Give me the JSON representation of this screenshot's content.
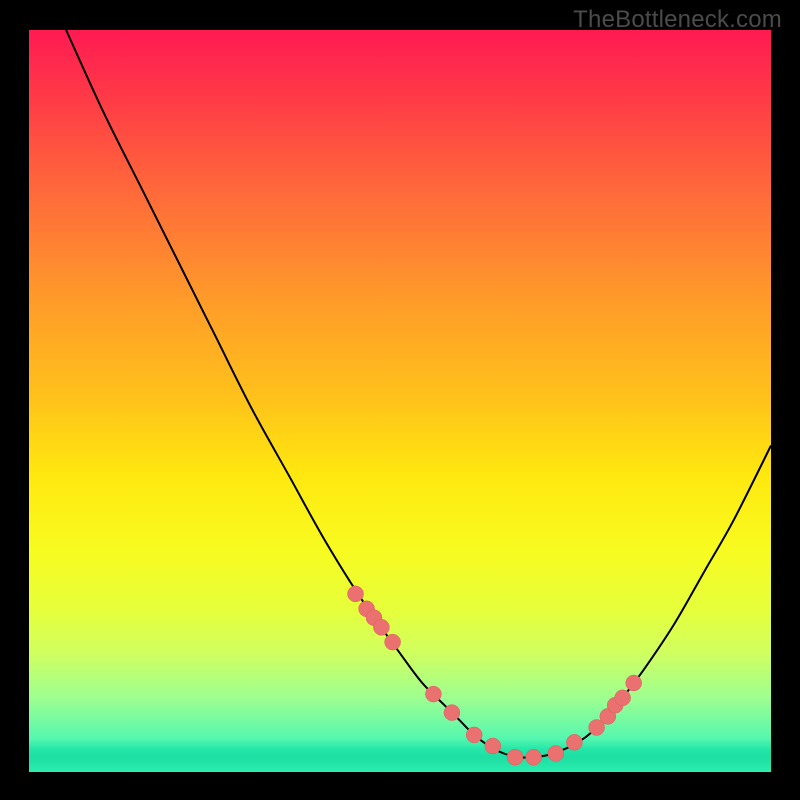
{
  "watermark": "TheBottleneck.com",
  "chart_data": {
    "type": "line",
    "title": "",
    "xlabel": "",
    "ylabel": "",
    "xlim": [
      0,
      100
    ],
    "ylim": [
      0,
      100
    ],
    "grid": false,
    "legend": false,
    "colors": {
      "curve": "#000000",
      "dots": "#eb7070",
      "gradient_top": "#ff1a52",
      "gradient_bottom": "#2aeeb0"
    },
    "series": [
      {
        "name": "bottleneck-curve",
        "x": [
          5,
          10,
          15,
          20,
          25,
          30,
          35,
          40,
          45,
          50,
          53,
          56,
          58,
          60,
          62,
          64,
          66,
          68,
          70,
          72,
          74,
          76,
          78,
          80,
          83,
          87,
          91,
          95,
          100
        ],
        "y": [
          100,
          89,
          79,
          69,
          59,
          49,
          40,
          31,
          23,
          16,
          12,
          9,
          7,
          5,
          3.5,
          2.5,
          2,
          2,
          2.3,
          3,
          4,
          5.5,
          7.5,
          10,
          14,
          20,
          27,
          34,
          44
        ]
      }
    ],
    "markers": {
      "name": "threshold-dots",
      "x": [
        44.0,
        45.5,
        46.5,
        47.5,
        49.0,
        54.5,
        57.0,
        60.0,
        62.5,
        65.5,
        68.0,
        71.0,
        73.5,
        76.5,
        78.0,
        79.0,
        80.0,
        81.5
      ],
      "y": [
        24.0,
        22.0,
        20.8,
        19.5,
        17.5,
        10.5,
        8.0,
        5.0,
        3.5,
        2.0,
        2.0,
        2.5,
        4.0,
        6.0,
        7.5,
        9.0,
        10.0,
        12.0
      ]
    }
  }
}
